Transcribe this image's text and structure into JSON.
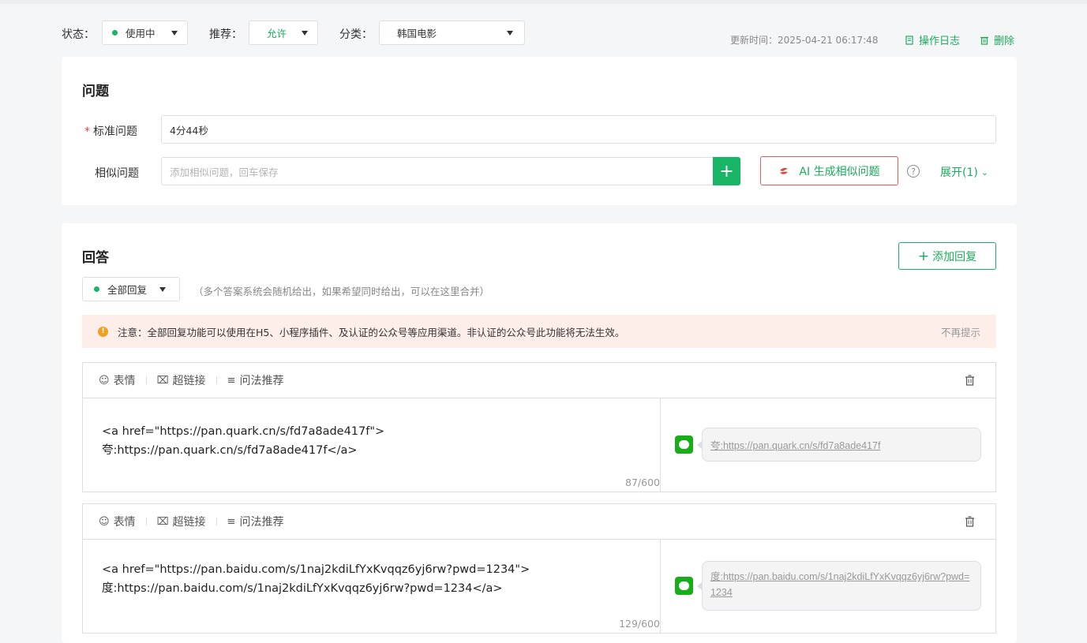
{
  "filters": {
    "status_label": "状态：",
    "status_value": "使用中",
    "recommend_label": "推荐：",
    "recommend_value": "允许",
    "category_label": "分类：",
    "category_value": "韩国电影",
    "update_time": "更新时间：2025-04-21 06:17:48",
    "log_button": "操作日志",
    "delete_button": "删除"
  },
  "question": {
    "title": "问题",
    "standard_label": "标准问题",
    "required_mark": "*",
    "standard_value": "4分44秒",
    "similar_label": "相似问题",
    "similar_placeholder": "添加相似问题，回车保存",
    "add_symbol": "+",
    "ai_button": "AI 生成相似问题",
    "help_symbol": "?",
    "expand_label": "展开(1)"
  },
  "answer": {
    "title": "回答",
    "add_reply_button": "添加回复",
    "reply_mode": "全部回复",
    "reply_hint": "（多个答案系统会随机给出，如果希望同时给出，可以在这里合并）",
    "notice_text": "注意：全部回复功能可以使用在H5、小程序插件、及认证的公众号等应用渠道。非认证的公众号此功能将无法生效。",
    "notice_dismiss": "不再提示",
    "toolbar": {
      "emoji": "表情",
      "hyperlink": "超链接",
      "recommend": "问法推荐"
    },
    "replies": [
      {
        "code": "<a href=\"https://pan.quark.cn/s/fd7a8ade417f\">\n夸:https://pan.quark.cn/s/fd7a8ade417f</a>",
        "count": "87/600",
        "preview": "夸:https://pan.quark.cn/s/fd7a8ade417f"
      },
      {
        "code": "<a href=\"https://pan.baidu.com/s/1naj2kdiLfYxKvqqz6yj6rw?pwd=1234\">\n度:https://pan.baidu.com/s/1naj2kdiLfYxKvqqz6yj6rw?pwd=1234</a>",
        "count": "129/600",
        "preview": "度:https://pan.baidu.com/s/1naj2kdiLfYxKvqqz6yj6rw?pwd=1234"
      }
    ]
  },
  "colors": {
    "brand_green": "#1aad5b",
    "ai_border_red": "#e65c5c",
    "notice_bg": "#fdeee9"
  }
}
